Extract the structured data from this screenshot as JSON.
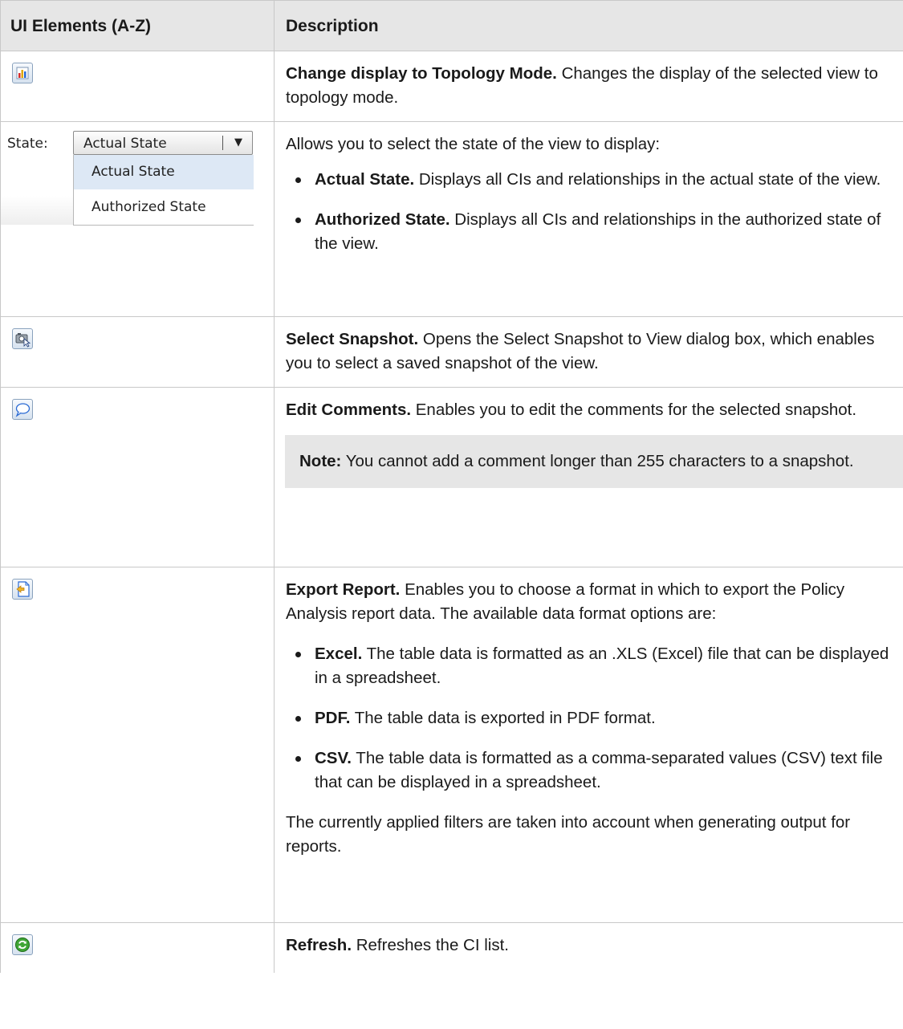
{
  "table": {
    "header": {
      "col1": "UI Elements (A-Z)",
      "col2": "Description"
    }
  },
  "rows": {
    "topology": {
      "icon": "chart-bar-icon",
      "title": "Change display to Topology Mode.",
      "text": " Changes the display of the selected view to topology mode."
    },
    "state": {
      "dropdown_label": "State:",
      "dropdown_value": "Actual State",
      "options": [
        "Actual State",
        "Authorized State"
      ],
      "intro": "Allows you to select the state of the view to display:",
      "bullets": [
        {
          "title": "Actual State.",
          "text": " Displays all CIs and relationships in the actual state of the view."
        },
        {
          "title": "Authorized State.",
          "text": " Displays all CIs and relationships in the authorized state of the view."
        }
      ]
    },
    "snapshot": {
      "icon": "select-snapshot-icon",
      "title": "Select Snapshot.",
      "text": " Opens the Select Snapshot to View dialog box, which enables you to select a saved snapshot of the view."
    },
    "comments": {
      "icon": "speech-bubble-icon",
      "title": "Edit Comments.",
      "text": " Enables you to edit the comments for the selected snapshot.",
      "note_title": "Note:",
      "note_text": " You cannot add a comment longer than 255 characters to a snapshot."
    },
    "export": {
      "icon": "export-report-icon",
      "title": "Export Report.",
      "text": " Enables you to choose a format in which to export the Policy Analysis report data. The available data format options are:",
      "bullets": [
        {
          "title": "Excel.",
          "text": " The table data is formatted as an .XLS (Excel) file that can be displayed in a spreadsheet."
        },
        {
          "title": "PDF.",
          "text": " The table data is exported in PDF format."
        },
        {
          "title": "CSV.",
          "text": " The table data is formatted as a comma-separated values (CSV) text file that can be displayed in a spreadsheet."
        }
      ],
      "footer": "The currently applied filters are taken into account when generating output for reports."
    },
    "refresh": {
      "icon": "refresh-icon",
      "title": "Refresh.",
      "text": " Refreshes the CI list."
    }
  },
  "colors": {
    "header_bg": "#e6e6e6",
    "note_bg": "#e6e6e6",
    "border": "#c8c8c8"
  }
}
